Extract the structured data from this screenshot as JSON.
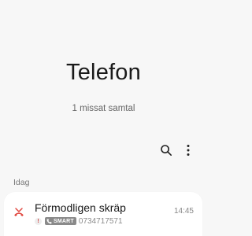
{
  "app": {
    "title": "Telefon",
    "missed_summary": "1 missat samtal"
  },
  "toolbar": {
    "search_icon": "search-icon",
    "more_icon": "more-vert-icon"
  },
  "section": {
    "label": "Idag"
  },
  "calls": [
    {
      "name": "Förmodligen skräp",
      "warning_mark": "!",
      "badge": "SMART",
      "number": "0734717571",
      "time": "14:45",
      "call_type_icon": "missed-call-icon",
      "icon_color": "#e0473f"
    }
  ],
  "colors": {
    "background": "#f7f7f7",
    "card": "#ffffff",
    "missed": "#e0473f",
    "badge": "#8a8a8a"
  }
}
